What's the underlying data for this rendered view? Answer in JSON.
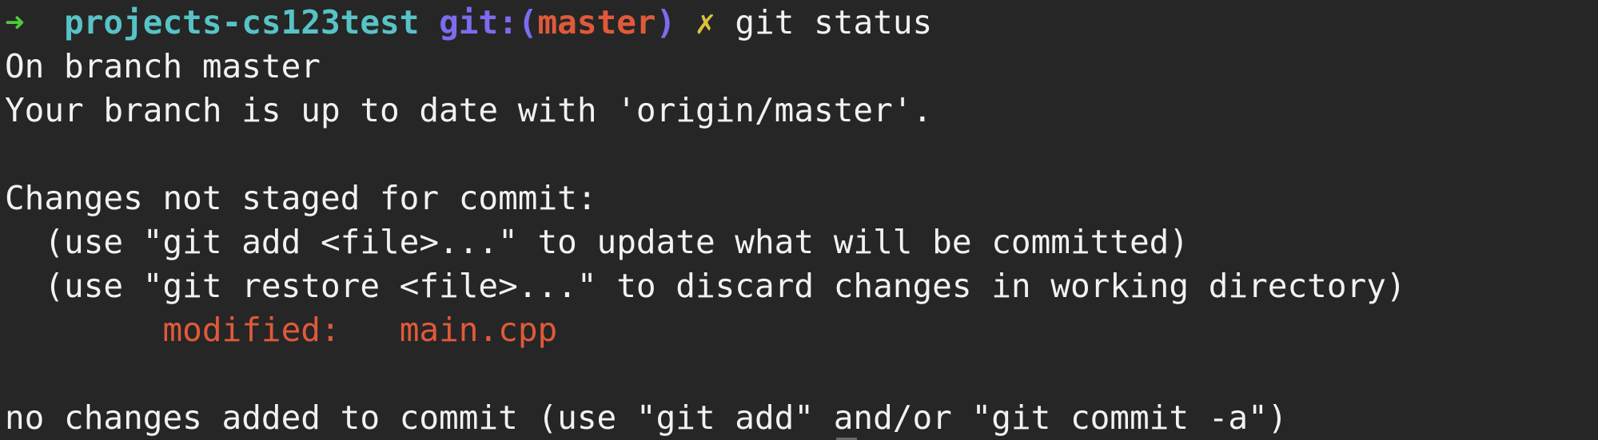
{
  "prompt": {
    "arrow": "➜",
    "directory": "projects-cs123test",
    "git_prefix": "git:(",
    "branch": "master",
    "git_suffix": ")",
    "dirty_marker": "✗",
    "command": "git status"
  },
  "output": {
    "line1": "On branch master",
    "line2": "Your branch is up to date with 'origin/master'.",
    "line3": "",
    "line4": "Changes not staged for commit:",
    "line5": "  (use \"git add <file>...\" to update what will be committed)",
    "line6": "  (use \"git restore <file>...\" to discard changes in working directory)",
    "modified_label": "modified:",
    "modified_file": "main.cpp",
    "line8": "",
    "line9": "no changes added to commit (use \"git add\" and/or \"git commit -a\")"
  },
  "colors": {
    "background": "#262626",
    "text": "#f2f2f2",
    "arrow": "#4ecb3a",
    "directory": "#57c3c7",
    "git_label": "#7b6cf0",
    "branch": "#e05a3a",
    "dirty_marker": "#d8c13e",
    "modified": "#e05a3a"
  }
}
